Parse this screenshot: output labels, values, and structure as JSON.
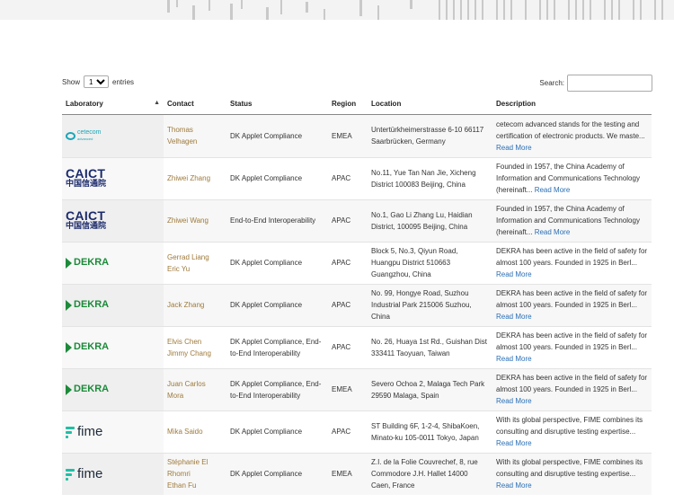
{
  "controls": {
    "show_label": "Show",
    "entries_value": "10",
    "entries_label": "entries",
    "search_label": "Search:",
    "search_value": ""
  },
  "table": {
    "headers": {
      "laboratory": "Laboratory",
      "contact": "Contact",
      "status": "Status",
      "region": "Region",
      "location": "Location",
      "description": "Description"
    },
    "read_more": "Read More",
    "rows": [
      {
        "logo": "cetecom",
        "logo_text": "cetecom",
        "logo_subtext": "advanced",
        "contact": [
          "Thomas",
          "Velhagen"
        ],
        "status": "DK Applet Compliance",
        "region": "EMEA",
        "location": "Untertürkheimerstrasse 6-10 66117 Saarbrücken, Germany",
        "description": "cetecom advanced stands for the testing and certification of electronic products. We maste..."
      },
      {
        "logo": "caict",
        "logo_text": "CAICT",
        "logo_subtext": "中国信通院",
        "contact": [
          "Zhiwei Zhang"
        ],
        "status": "DK Applet Compliance",
        "region": "APAC",
        "location": "No.11, Yue Tan Nan Jie, Xicheng District 100083 Beijing, China",
        "description": "Founded in 1957, the China Academy of Information and Communications Technology (hereinaft..."
      },
      {
        "logo": "caict",
        "logo_text": "CAICT",
        "logo_subtext": "中国信通院",
        "contact": [
          "Zhiwei Wang"
        ],
        "status": "End-to-End Interoperability",
        "region": "APAC",
        "location": "No.1, Gao Li Zhang Lu, Haidian District, 100095 Beijing, China",
        "description": "Founded in 1957, the China Academy of Information and Communications Technology (hereinaft..."
      },
      {
        "logo": "dekra",
        "logo_text": "DEKRA",
        "contact": [
          "Gerrad Liang",
          "Eric Yu"
        ],
        "status": "DK Applet Compliance",
        "region": "APAC",
        "location": "Block 5, No.3, Qiyun Road, Huangpu District 510663 Guangzhou, China",
        "description": "DEKRA has been active in the field of safety for almost 100 years. Founded in 1925 in Berl..."
      },
      {
        "logo": "dekra",
        "logo_text": "DEKRA",
        "contact": [
          "Jack Zhang"
        ],
        "status": "DK Applet Compliance",
        "region": "APAC",
        "location": "No. 99, Hongye Road, Suzhou Industrial Park 215006 Suzhou, China",
        "description": "DEKRA has been active in the field of safety for almost 100 years. Founded in 1925 in Berl..."
      },
      {
        "logo": "dekra",
        "logo_text": "DEKRA",
        "contact": [
          "Elvis Chen",
          "Jimmy Chang"
        ],
        "status": "DK Applet Compliance, End-to-End Interoperability",
        "region": "APAC",
        "location": "No. 26, Huaya 1st Rd., Guishan Dist 333411 Taoyuan, Taiwan",
        "description": "DEKRA has been active in the field of safety for almost 100 years. Founded in 1925 in Berl..."
      },
      {
        "logo": "dekra",
        "logo_text": "DEKRA",
        "contact": [
          "Juan Carlos",
          "Mora"
        ],
        "status": "DK Applet Compliance, End-to-End Interoperability",
        "region": "EMEA",
        "location": "Severo Ochoa 2, Malaga Tech Park 29590 Malaga, Spain",
        "description": "DEKRA has been active in the field of safety for almost 100 years. Founded in 1925 in Berl..."
      },
      {
        "logo": "fime",
        "logo_text": "fime",
        "contact": [
          "Mika Saido"
        ],
        "status": "DK Applet Compliance",
        "region": "APAC",
        "location": "ST Building 6F, 1-2-4, ShibaKoen, Minato-ku 105-0011 Tokyo, Japan",
        "description": "With its global perspective, FIME combines its consulting and disruptive testing expertise..."
      },
      {
        "logo": "fime",
        "logo_text": "fime",
        "contact": [
          "Stéphanie El",
          "Rhomri",
          "Ethan Fu"
        ],
        "status": "DK Applet Compliance",
        "region": "EMEA",
        "location": "Z.I. de la Folie Couvrechef, 8, rue Commodore J.H. Hallet 14000 Caen, France",
        "description": "With its global perspective, FIME combines its consulting and disruptive testing expertise..."
      }
    ]
  },
  "colors": {
    "link": "#2a6fb5",
    "contact": "#9e7a3b",
    "caict": "#1b2a6b",
    "dekra": "#1c8a3a",
    "fime_mark": "#1fbfa5",
    "cetecom": "#1aa6b7"
  }
}
